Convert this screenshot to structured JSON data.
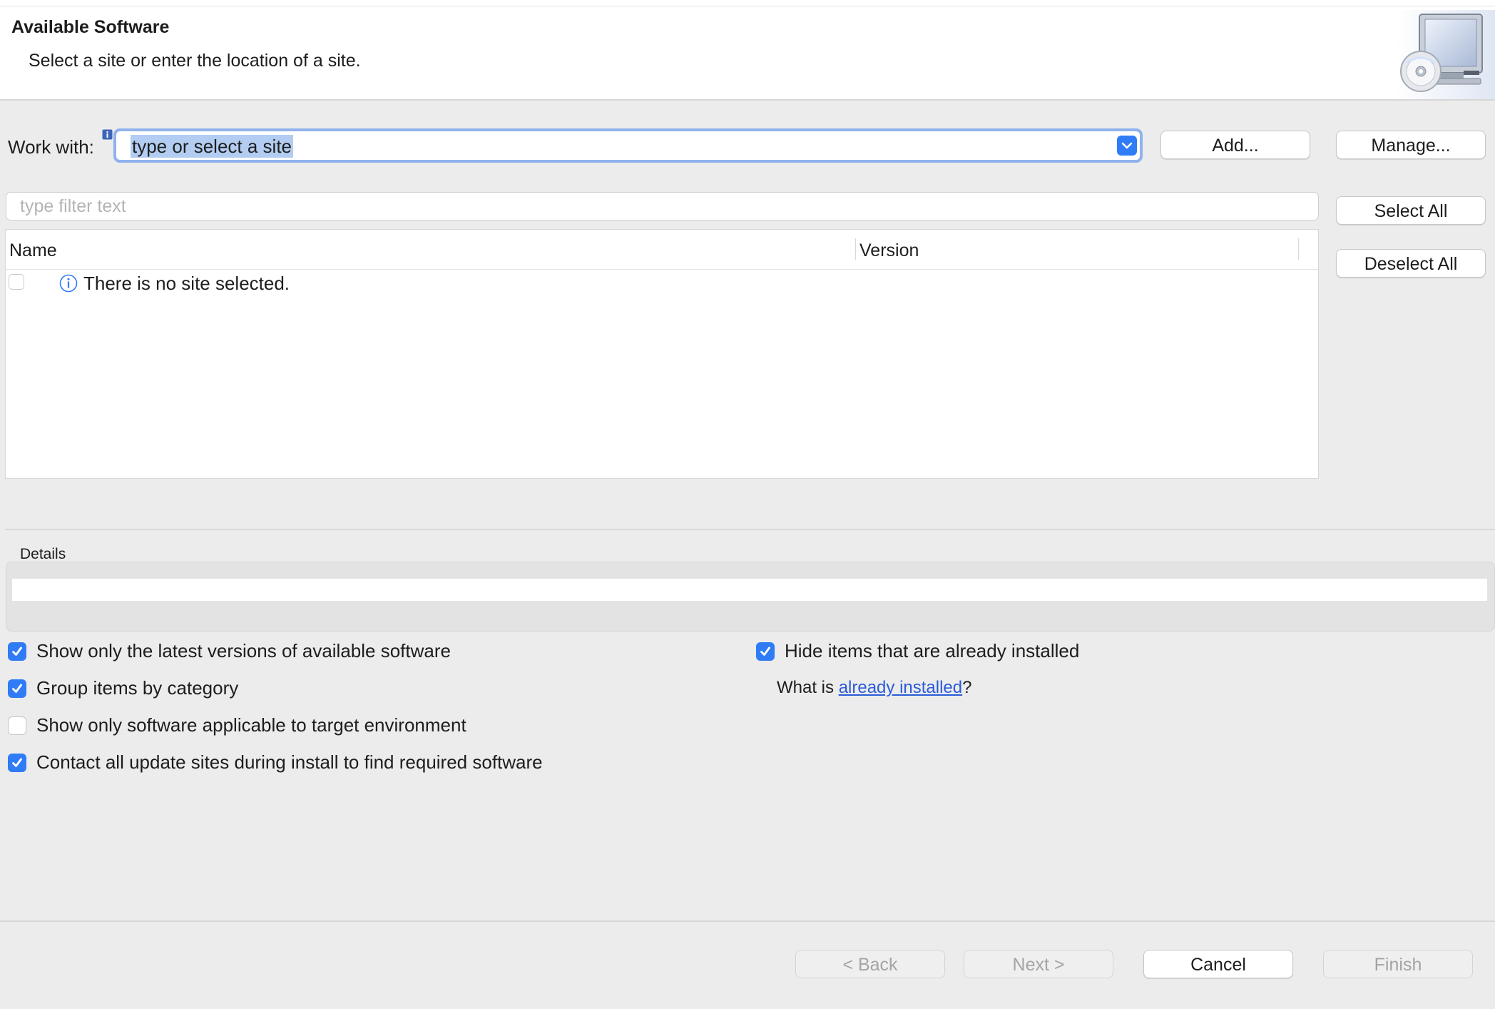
{
  "header": {
    "title": "Available Software",
    "subtitle": "Select a site or enter the location of a site.",
    "icon": "install-software-icon"
  },
  "work_with": {
    "label": "Work with:",
    "value": "type or select a site",
    "add_button": "Add...",
    "manage_button": "Manage..."
  },
  "filter": {
    "placeholder": "type filter text"
  },
  "side_buttons": {
    "select_all": "Select All",
    "deselect_all": "Deselect All"
  },
  "table": {
    "columns": [
      "Name",
      "Version"
    ],
    "rows": [
      {
        "checked": false,
        "icon": "info-icon",
        "name": "There is no site selected.",
        "version": ""
      }
    ]
  },
  "details": {
    "label": "Details",
    "text": ""
  },
  "options": {
    "left": [
      {
        "label": "Show only the latest versions of available software",
        "checked": true
      },
      {
        "label": "Group items by category",
        "checked": true
      },
      {
        "label": "Show only software applicable to target environment",
        "checked": false
      },
      {
        "label": "Contact all update sites during install to find required software",
        "checked": true
      }
    ],
    "hide_installed": {
      "label": "Hide items that are already installed",
      "checked": true
    },
    "what_is_prefix": "What is ",
    "what_is_link": "already installed",
    "what_is_suffix": "?"
  },
  "footer": {
    "back": "< Back",
    "next": "Next >",
    "cancel": "Cancel",
    "finish": "Finish",
    "back_enabled": false,
    "next_enabled": false,
    "cancel_enabled": true,
    "finish_enabled": false
  },
  "colors": {
    "accent": "#2f7cf6",
    "selection": "#b3cdf2",
    "link": "#2a5cd8"
  }
}
